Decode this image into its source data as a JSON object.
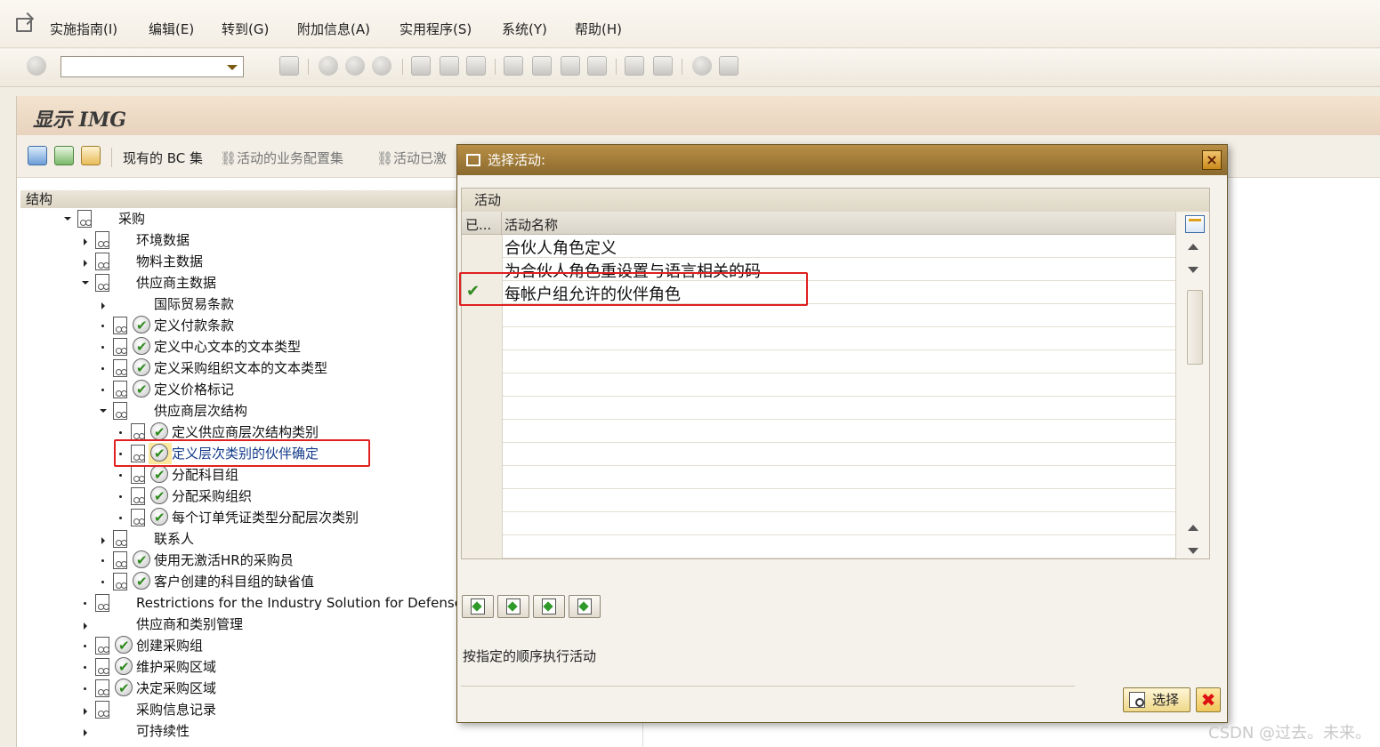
{
  "menubar": {
    "items": [
      "实施指南(I)",
      "编辑(E)",
      "转到(G)",
      "附加信息(A)",
      "实用程序(S)",
      "系统(Y)",
      "帮助(H)"
    ]
  },
  "toolbar": {
    "command_field_value": "",
    "icons": [
      "enter-icon",
      "back-icon",
      "exit-icon",
      "cancel-icon",
      "print-icon",
      "find-icon",
      "find-next-icon",
      "first-page-icon",
      "prev-page-icon",
      "next-page-icon",
      "last-page-icon",
      "new-session-icon",
      "shortcut-icon",
      "help-icon",
      "layout-icon"
    ]
  },
  "screen": {
    "title": "显示 IMG",
    "app_toolbar": {
      "bc_sets": "现有的 BC 集",
      "active_bc_sets": "活动的业务配置集",
      "activated": "活动已激"
    }
  },
  "tree": {
    "header": "结构",
    "nodes": [
      {
        "label": "采购",
        "level": 0,
        "expander": "down",
        "exec": false
      },
      {
        "label": "环境数据",
        "level": 1,
        "expander": "right",
        "exec": false
      },
      {
        "label": "物料主数据",
        "level": 1,
        "expander": "right",
        "exec": false
      },
      {
        "label": "供应商主数据",
        "level": 1,
        "expander": "down",
        "exec": false
      },
      {
        "label": "国际贸易条款",
        "level": 2,
        "expander": "right",
        "exec": false,
        "noicon": true
      },
      {
        "label": "定义付款条款",
        "level": 2,
        "expander": "dot",
        "exec": true
      },
      {
        "label": "定义中心文本的文本类型",
        "level": 2,
        "expander": "dot",
        "exec": true
      },
      {
        "label": "定义采购组织文本的文本类型",
        "level": 2,
        "expander": "dot",
        "exec": true
      },
      {
        "label": "定义价格标记",
        "level": 2,
        "expander": "dot",
        "exec": true
      },
      {
        "label": "供应商层次结构",
        "level": 2,
        "expander": "down",
        "exec": false
      },
      {
        "label": "定义供应商层次结构类别",
        "level": 3,
        "expander": "dot",
        "exec": true
      },
      {
        "label": "定义层次类别的伙伴确定",
        "level": 3,
        "expander": "dot",
        "exec": true,
        "highlight": true
      },
      {
        "label": "分配科目组",
        "level": 3,
        "expander": "dot",
        "exec": true
      },
      {
        "label": "分配采购组织",
        "level": 3,
        "expander": "dot",
        "exec": true
      },
      {
        "label": "每个订单凭证类型分配层次类别",
        "level": 3,
        "expander": "dot",
        "exec": true
      },
      {
        "label": "联系人",
        "level": 2,
        "expander": "right",
        "exec": false
      },
      {
        "label": "使用无激活HR的采购员",
        "level": 2,
        "expander": "dot",
        "exec": true
      },
      {
        "label": "客户创建的科目组的缺省值",
        "level": 2,
        "expander": "dot",
        "exec": true
      },
      {
        "label": "Restrictions for the Industry Solution for Defense",
        "level": 1,
        "expander": "dot",
        "exec": false
      },
      {
        "label": "供应商和类别管理",
        "level": 1,
        "expander": "right",
        "exec": false,
        "noicon": true
      },
      {
        "label": "创建采购组",
        "level": 1,
        "expander": "dot",
        "exec": true
      },
      {
        "label": "维护采购区域",
        "level": 1,
        "expander": "dot",
        "exec": true
      },
      {
        "label": "决定采购区域",
        "level": 1,
        "expander": "dot",
        "exec": true
      },
      {
        "label": "采购信息记录",
        "level": 1,
        "expander": "right",
        "exec": false
      },
      {
        "label": "可持续性",
        "level": 1,
        "expander": "right",
        "exec": false,
        "noicon": true
      }
    ]
  },
  "dialog": {
    "title": "选择活动:",
    "grid_caption": "活动",
    "col_done": "已...",
    "col_name": "活动名称",
    "rows": [
      {
        "name": "合伙人角色定义",
        "done": false
      },
      {
        "name": "为合伙人角色重设置与语言相关的码",
        "done": false
      },
      {
        "name": "每帐户组允许的伙伴角色",
        "done": true
      }
    ],
    "hint": "按指定的顺序执行活动",
    "choose_label": "选择",
    "cancel_icon": "cancel-icon"
  },
  "watermark": "CSDN @过去。未来。",
  "colors": {
    "dialog_title": "#9c7836",
    "highlight": "#fde8a0",
    "annotation_red": "#e02020",
    "check_green": "#2f8a1f"
  }
}
